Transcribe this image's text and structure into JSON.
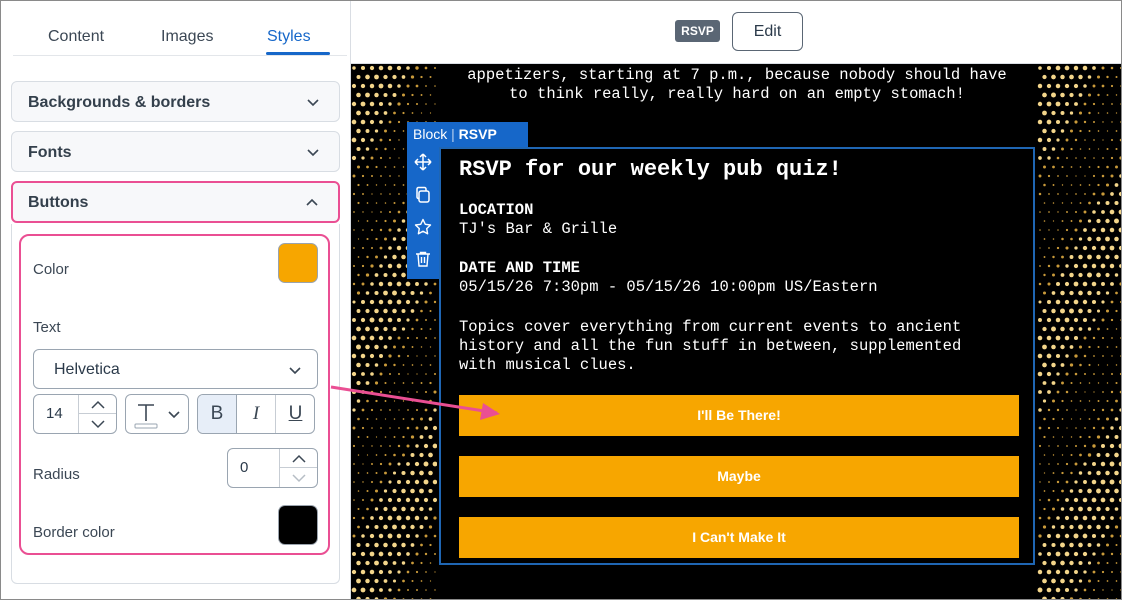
{
  "panel": {
    "tabs": [
      {
        "label": "Content",
        "active": false
      },
      {
        "label": "Images",
        "active": false
      },
      {
        "label": "Styles",
        "active": true
      }
    ],
    "sections": {
      "backgrounds": "Backgrounds & borders",
      "fonts": "Fonts",
      "buttons": "Buttons"
    },
    "buttons_settings": {
      "color_label": "Color",
      "color_value": "#f7a600",
      "text_label": "Text",
      "font_family": "Helvetica",
      "font_size": "14",
      "style_bold": "B",
      "style_italic": "I",
      "style_underline": "U",
      "bold_active": true,
      "radius_label": "Radius",
      "radius_value": "0",
      "border_color_label": "Border color",
      "border_color_value": "#000000"
    }
  },
  "topbar": {
    "badge": "RSVP",
    "edit_label": "Edit"
  },
  "preview": {
    "intro_line1": "appetizers, starting at 7 p.m., because nobody should have",
    "intro_line2": "to think really, really hard on an empty stomach!",
    "block_tag_prefix": "Block",
    "block_tag_name": "RSVP",
    "title": "RSVP for our weekly pub quiz!",
    "location_heading": "LOCATION",
    "location_value": "TJ's Bar & Grille",
    "datetime_heading": "DATE AND TIME",
    "datetime_value": "05/15/26 7:30pm - 05/15/26 10:00pm US/Eastern",
    "description_line1": "Topics cover everything from current events to ancient",
    "description_line2": "history and all the fun stuff in between, supplemented",
    "description_line3": "with musical clues.",
    "rsvp_buttons": [
      "I'll Be There!",
      "Maybe",
      "I Can't Make It"
    ],
    "button_color": "#f7a600",
    "block_outline_color": "#1f66b3",
    "highlight_color": "#ea4f93"
  }
}
